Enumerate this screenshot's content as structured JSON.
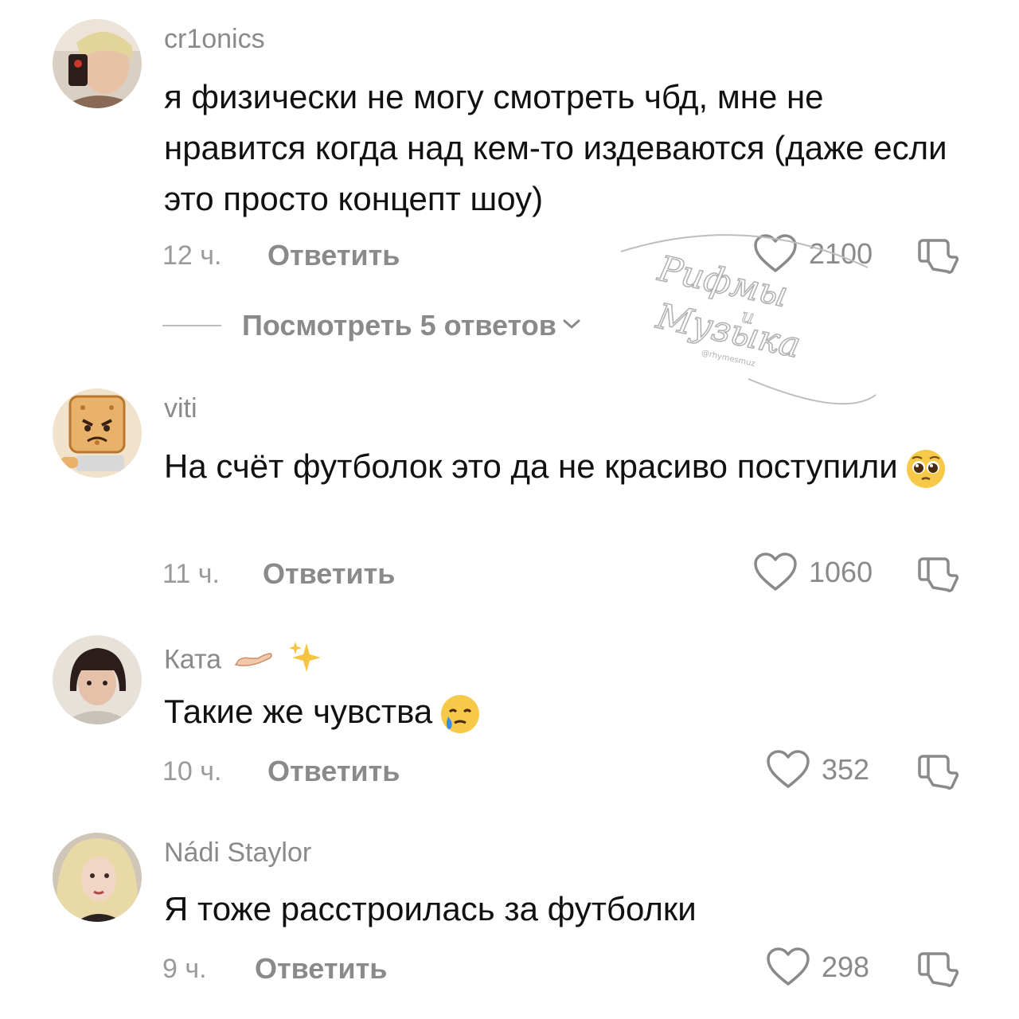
{
  "comments": [
    {
      "username": "cr1onics",
      "text": "я физически не могу смотреть чбд, мне не нравится когда над кем-то издеваются (даже если это просто концепт шоу)",
      "time": "12 ч.",
      "reply_label": "Ответить",
      "likes": "2100",
      "view_replies": "Посмотреть 5 ответов"
    },
    {
      "username": "viti",
      "text": "На счёт футболок это да не красиво поступили",
      "emoji": "pleading-face",
      "time": "11 ч.",
      "reply_label": "Ответить",
      "likes": "1060"
    },
    {
      "username": "Ката",
      "username_emojis": [
        "palm-up-hand",
        "sparkles"
      ],
      "text": "Такие же чувства",
      "emoji": "face-holding-back-tears",
      "time": "10 ч.",
      "reply_label": "Ответить",
      "likes": "352"
    },
    {
      "username": "Nádi Staylor",
      "text": "Я тоже расстроилась за футболки",
      "time": "9 ч.",
      "reply_label": "Ответить",
      "likes": "298"
    }
  ],
  "icons": {
    "like": "heart-outline-icon",
    "dislike": "thumbs-down-outline-icon",
    "expand": "chevron-down-icon"
  },
  "watermark": {
    "line1": "Рифмы",
    "line2": "и",
    "line3": "Музыка",
    "handle": "@rhymesmuz"
  },
  "colors": {
    "text": "#111111",
    "secondary": "#8a8a8a",
    "background": "#ffffff"
  }
}
